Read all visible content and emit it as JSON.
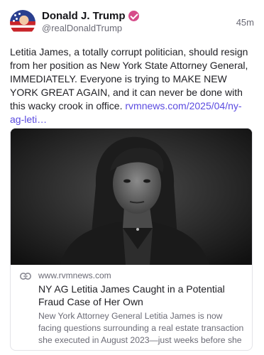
{
  "post": {
    "author": {
      "display_name": "Donald J. Trump",
      "handle": "@realDonaldTrump",
      "verified": true,
      "verified_badge_color": "#d64c8a",
      "avatar_icon": "flag-portrait-avatar"
    },
    "timestamp": "45m",
    "text": "Letitia James, a totally corrupt politician, should resign from her position as New York State Attorney General, IMMEDIATELY. Everyone is trying to MAKE NEW YORK GREAT AGAIN, and it can never be done with this wacky crook in office.",
    "link_text": "rvmnews.com/2025/04/ny-ag-leti…",
    "link_color": "#5b4be0"
  },
  "card": {
    "image_icon": "news-photo-grayscale-portrait",
    "link_icon": "link-icon",
    "domain": "www.rvmnews.com",
    "title": "NY AG Letitia James Caught in a Potential Fraud Case of Her Own",
    "description": "New York Attorney General Letitia James is now facing questions surrounding a real estate transaction she executed in August 2023—just weeks before she"
  }
}
